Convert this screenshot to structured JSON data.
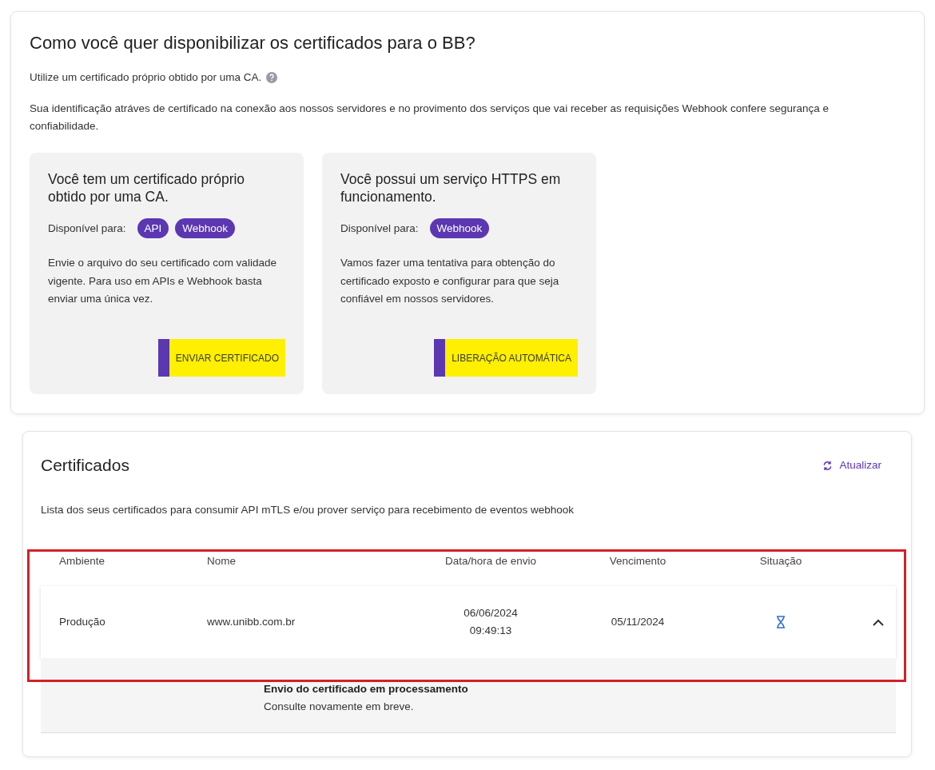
{
  "setup": {
    "title": "Como você quer disponibilizar os certificados para o BB?",
    "subtitle": "Utilize um certificado próprio obtido por uma CA.",
    "description": "Sua identificação atráves de certificado na conexão aos nossos servidores e no provimento dos serviços que vai receber as requisições Webhook confere segurança e confiabilidade.",
    "options": [
      {
        "title": "Você tem um certificado próprio obtido por uma CA.",
        "available_label": "Disponível para:",
        "tags": [
          "API",
          "Webhook"
        ],
        "text": "Envie o arquivo do seu certificado com validade vigente. Para uso em APIs e Webhook basta enviar uma única vez.",
        "button": "ENVIAR CERTIFICADO"
      },
      {
        "title": "Você possui um serviço HTTPS em funcionamento.",
        "available_label": "Disponível para:",
        "tags": [
          "Webhook"
        ],
        "text": "Vamos fazer uma tentativa para obtenção do certificado exposto e configurar para que seja confiável em nossos servidores.",
        "button": "LIBERAÇÃO AUTOMÁTICA"
      }
    ]
  },
  "certificates": {
    "title": "Certificados",
    "refresh": "Atualizar",
    "description": "Lista dos seus certificados para consumir API mTLS e/ou prover serviço para recebimento de eventos webhook",
    "highlighted": true,
    "table": {
      "columns": [
        "Ambiente",
        "Nome",
        "Data/hora de envio",
        "Vencimento",
        "Situação"
      ],
      "rows": [
        {
          "environment": "Produção",
          "name": "www.unibb.com.br",
          "sent_date": "06/06/2024",
          "sent_time": "09:49:13",
          "expiry": "05/11/2024",
          "kind": "pending",
          "expanded": true,
          "detail_title": "Envio do certificado em processamento",
          "detail_text": "Consulte novamente em breve."
        }
      ]
    }
  }
}
